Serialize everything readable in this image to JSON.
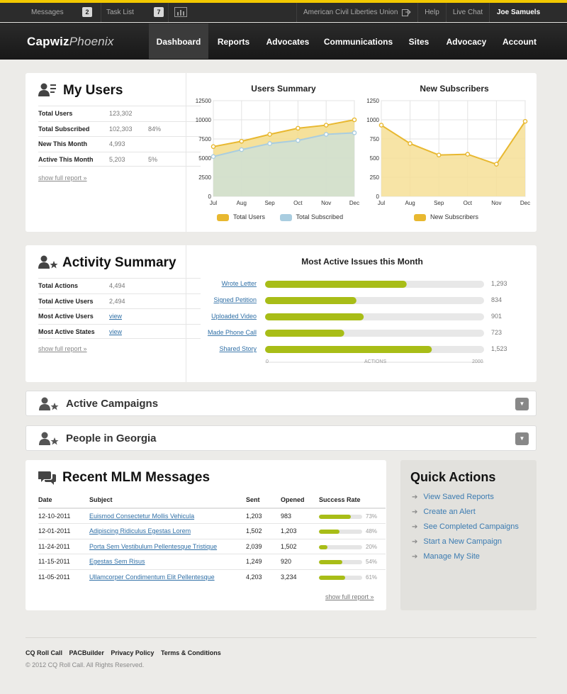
{
  "topbar": {
    "messages": "Messages",
    "messages_count": "2",
    "task_list": "Task List",
    "task_count": "7",
    "org": "American Civil Liberties Union",
    "help": "Help",
    "live_chat": "Live Chat",
    "user": "Joe Samuels"
  },
  "nav": {
    "logo_bold": "Capwiz",
    "logo_italic": "Phoenix",
    "items": [
      "Dashboard",
      "Reports",
      "Advocates",
      "Communications",
      "Sites",
      "Advocacy",
      "Account"
    ]
  },
  "my_users": {
    "title": "My Users",
    "rows": [
      {
        "k": "Total Users",
        "v": "123,302",
        "p": ""
      },
      {
        "k": "Total Subscribed",
        "v": "102,303",
        "p": "84%"
      },
      {
        "k": "New This Month",
        "v": "4,993",
        "p": ""
      },
      {
        "k": "Active This Month",
        "v": "5,203",
        "p": "5%"
      }
    ],
    "show_full": "show full report »"
  },
  "users_summary": {
    "title": "Users Summary",
    "legend": [
      "Total Users",
      "Total Subscribed"
    ]
  },
  "new_subscribers": {
    "title": "New Subscribers",
    "legend": [
      "New Subscribers"
    ]
  },
  "activity": {
    "title": "Activity Summary",
    "rows": [
      {
        "k": "Total Actions",
        "v": "4,494"
      },
      {
        "k": "Total Active Users",
        "v": "2,494"
      },
      {
        "k": "Most Active  Users",
        "v": "view"
      },
      {
        "k": "Most Active States",
        "v": "view"
      }
    ],
    "show_full": "show full report »"
  },
  "issues": {
    "title": "Most Active Issues this Month",
    "axis_min": "0",
    "axis_label": "ACTIONS",
    "axis_max": "2000"
  },
  "campaigns": {
    "title": "Active Campaigns"
  },
  "georgia": {
    "title": "People in Georgia"
  },
  "messages": {
    "title": "Recent MLM Messages",
    "headers": [
      "Date",
      "Subject",
      "Sent",
      "Opened",
      "Success Rate"
    ],
    "rows": [
      {
        "date": "12-10-2011",
        "subject": "Euismod Consectetur Mollis Vehicula",
        "sent": "1,203",
        "opened": "983",
        "rate": 0.73,
        "pct": "73%"
      },
      {
        "date": "12-01-2011",
        "subject": "Adipiscing Ridiculus Egestas Lorem",
        "sent": "1,502",
        "opened": "1,203",
        "rate": 0.48,
        "pct": "48%"
      },
      {
        "date": "11-24-2011",
        "subject": "Porta Sem Vestibulum Pellentesque Tristique",
        "sent": "2,039",
        "opened": "1,502",
        "rate": 0.2,
        "pct": "20%"
      },
      {
        "date": "11-15-2011",
        "subject": "Egestas Sem Risus",
        "sent": "1,249",
        "opened": "920",
        "rate": 0.54,
        "pct": "54%"
      },
      {
        "date": "11-05-2011",
        "subject": "Ullamcorper Condimentum Elit Pellentesque",
        "sent": "4,203",
        "opened": "3,234",
        "rate": 0.61,
        "pct": "61%"
      }
    ],
    "show_full": "show full report »"
  },
  "quick_actions": {
    "title": "Quick Actions",
    "items": [
      "View Saved Reports",
      "Create an Alert",
      "See Completed Campaigns",
      "Start a New Campaign",
      "Manage My Site"
    ]
  },
  "footer": {
    "links": [
      "CQ Roll Call",
      "PACBuilder",
      "Privacy Policy",
      "Terms & Conditions"
    ],
    "copyright": "© 2012 CQ Roll Call. All Rights Reserved."
  },
  "colors": {
    "accent": "#f2c800",
    "bar": "#a8bd17",
    "line_yellow": "#e8b830",
    "line_blue": "#a9cde0",
    "link": "#2f6fa6"
  },
  "chart_data": [
    {
      "type": "area",
      "title": "Users Summary",
      "categories": [
        "Jul",
        "Aug",
        "Sep",
        "Oct",
        "Nov",
        "Dec"
      ],
      "ylim": [
        0,
        12500
      ],
      "yticks": [
        0,
        2500,
        5000,
        7500,
        10000,
        12500
      ],
      "series": [
        {
          "name": "Total Users",
          "values": [
            6500,
            7200,
            8100,
            8900,
            9300,
            10000
          ]
        },
        {
          "name": "Total Subscribed",
          "values": [
            5200,
            6100,
            6900,
            7300,
            8100,
            8300
          ]
        }
      ],
      "grid": true,
      "legend": "bottom"
    },
    {
      "type": "area",
      "title": "New Subscribers",
      "categories": [
        "Jul",
        "Aug",
        "Sep",
        "Oct",
        "Nov",
        "Dec"
      ],
      "ylim": [
        0,
        1250
      ],
      "yticks": [
        0,
        250,
        500,
        750,
        1000,
        1250
      ],
      "series": [
        {
          "name": "New Subscribers",
          "values": [
            930,
            690,
            540,
            550,
            420,
            980
          ]
        }
      ],
      "grid": true,
      "legend": "bottom"
    },
    {
      "type": "bar",
      "title": "Most Active Issues this Month",
      "orientation": "horizontal",
      "categories": [
        "Wrote Letter",
        "Signed Petition",
        "Uploaded Video",
        "Made Phone Call",
        "Shared Story"
      ],
      "values": [
        1293,
        834,
        901,
        723,
        1523
      ],
      "value_labels": [
        "1,293",
        "834",
        "901",
        "723",
        "1,523"
      ],
      "xlim": [
        0,
        2000
      ],
      "xlabel": "ACTIONS"
    }
  ]
}
